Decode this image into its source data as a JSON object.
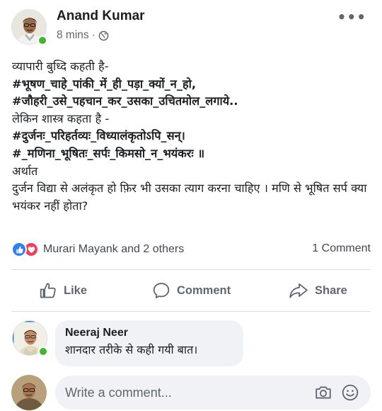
{
  "post": {
    "author": "Anand Kumar",
    "time": "8 mins",
    "separator": "·",
    "privacy_icon": "globe-icon",
    "more_icon": "•••",
    "text_lines": {
      "l1": "व्यापारी बुध्दि कहती है-",
      "l2": "#भूषण_चाहे_पांकी_में_ही_पड़ा_क्यों_न_हो,",
      "l3": "#जौहरी_उसे_पहचान_कर_उसका_उचितमोल_लगाये..",
      "l4": "लेकिन शास्त्र कहता है -",
      "l5": "#दुर्जनः_परिहर्तव्यः_विध्यालंकृतोऽपि_सन्।",
      "l6": "#_मणिना_भूषितः_सर्पः_किमसो_न_भयंकरः ॥",
      "l7": "अर्थात",
      "l8": "दुर्जन विद्या से अलंकृत हो फ़िर भी उसका त्याग करना चाहिए । मणि से भूषित सर्प क्या भयंकर नहीं होता?"
    }
  },
  "reactions": {
    "icons": [
      "like-reaction-icon",
      "love-reaction-icon"
    ],
    "summary": "Murari Mayank and 2 others",
    "comments_count": "1 Comment"
  },
  "actions": {
    "like": "Like",
    "comment": "Comment",
    "share": "Share"
  },
  "comment": {
    "author": "Neeraj Neer",
    "text": "शानदार तरीके से कही गयी बात।"
  },
  "composer": {
    "placeholder": "Write a comment...",
    "icons": [
      "camera-icon",
      "smile-icon"
    ]
  },
  "colors": {
    "text": "#1c1e21",
    "secondary": "#65676b",
    "online": "#42b72a",
    "like_blue": "#2e81f4",
    "love_red": "#f33e58",
    "bubble": "#f0f2f5",
    "divider": "#dadde1"
  }
}
